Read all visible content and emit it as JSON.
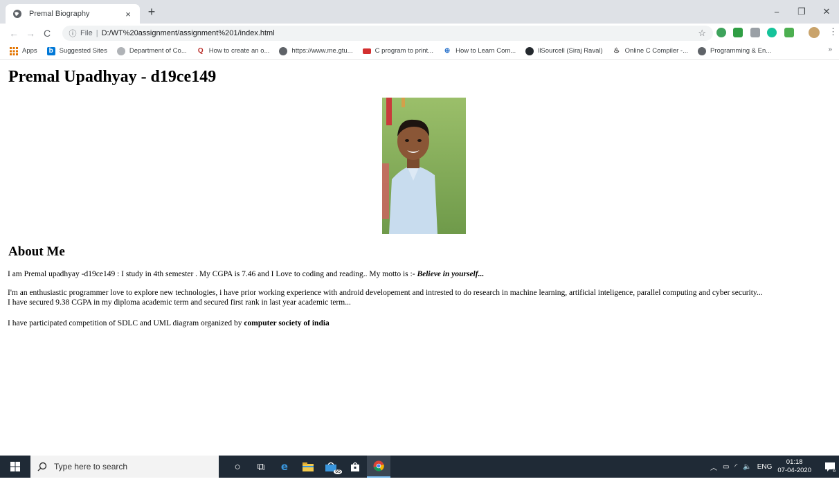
{
  "browser": {
    "tab_title": "Premal Biography",
    "tab_close": "×",
    "new_tab": "+",
    "window_minimize": "−",
    "window_restore": "❐",
    "window_close": "✕",
    "address_scheme": "File",
    "address_url": "D:/WT%20assignment/assignment%201/index.html"
  },
  "bookmarks": {
    "items": [
      {
        "label": "Apps",
        "icon": "apps-grid-icon"
      },
      {
        "label": "Suggested Sites",
        "icon": "bing-icon"
      },
      {
        "label": "Department of Co...",
        "icon": "globe-icon"
      },
      {
        "label": "How to create an o...",
        "icon": "quora-icon"
      },
      {
        "label": "https://www.me.gtu...",
        "icon": "globe-icon"
      },
      {
        "label": "C program to print...",
        "icon": "codechef-icon"
      },
      {
        "label": "How to Learn Com...",
        "icon": "coursera-icon"
      },
      {
        "label": "llSourcell (Siraj Raval)",
        "icon": "github-icon"
      },
      {
        "label": "Online C Compiler -...",
        "icon": "compiler-icon"
      },
      {
        "label": "Programming & En...",
        "icon": "globe-icon"
      }
    ],
    "more": "»"
  },
  "page": {
    "heading": "Premal Upadhyay - d19ce149",
    "about_heading": "About Me",
    "p1_text": "I am Premal upadhyay -d19ce149 : I study in 4th semester . My CGPA is 7.46 and I Love to coding and reading.. My motto is :- ",
    "p1_motto": "Believe in yourself...",
    "p2_line1": "I'm an enthusiastic programmer love to explore new technologies, i have prior working experience with android developement and intrested to do research in machine learning, artificial inteligence, parallel computing and cyber security...",
    "p2_line2": "I have secured 9.38 CGPA in my diploma academic term and secured first rank in last year academic term...",
    "p3_text": "I have participated competition of SDLC and UML diagram organized by ",
    "p3_bold": "computer society of india"
  },
  "taskbar": {
    "search_placeholder": "Type here to search",
    "store_badge": "65",
    "tray_language": "ENG",
    "clock_time": "01:18",
    "clock_date": "07-04-2020",
    "notification_count": "6"
  }
}
